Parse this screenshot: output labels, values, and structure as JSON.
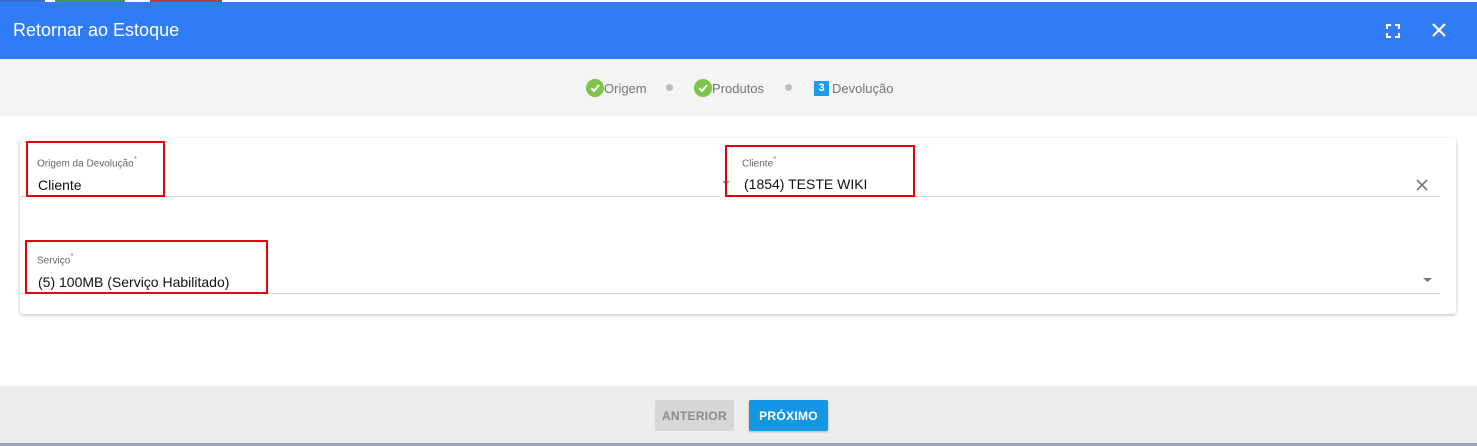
{
  "dialog": {
    "title": "Retornar ao Estoque",
    "accent_color": "#2f7cf6"
  },
  "stepper": {
    "steps": [
      {
        "label": "Origem",
        "state": "done",
        "icon": "check-circle-icon"
      },
      {
        "label": "Produtos",
        "state": "done",
        "icon": "check-circle-icon"
      },
      {
        "label": "Devolução",
        "state": "current",
        "number": "3"
      }
    ]
  },
  "form": {
    "origem": {
      "label": "Origem da Devolução",
      "required_mark": "*",
      "value": "Cliente"
    },
    "cliente": {
      "label": "Cliente",
      "required_mark": "*",
      "value": "(1854) TESTE WIKI",
      "clear_icon": "close-icon"
    },
    "servico": {
      "label": "Serviço",
      "required_mark": "*",
      "value": "(5) 100MB (Serviço Habilitado)",
      "dropdown_icon": "caret-down-icon"
    }
  },
  "footer": {
    "prev_label": "ANTERIOR",
    "next_label": "PRÓXIMO"
  }
}
